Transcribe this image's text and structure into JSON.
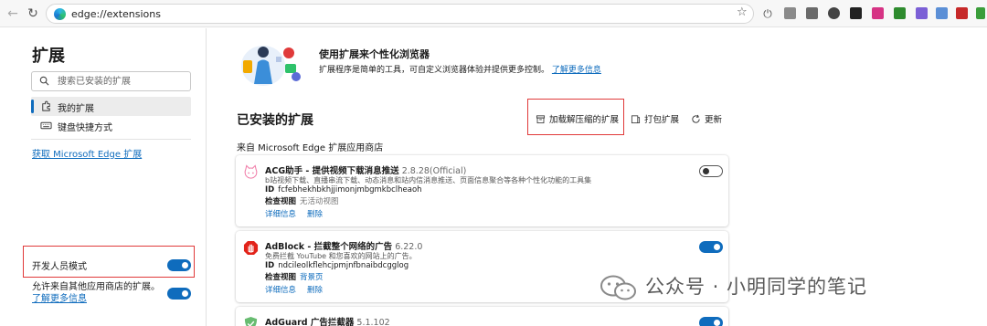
{
  "browser": {
    "url": "edge://extensions"
  },
  "sidebar": {
    "title": "扩展",
    "search_placeholder": "搜索已安装的扩展",
    "items": [
      {
        "label": "我的扩展",
        "active": true
      },
      {
        "label": "键盘快捷方式",
        "active": false
      }
    ],
    "store_link": "获取 Microsoft Edge 扩展",
    "dev_mode": {
      "label": "开发人员模式",
      "on": true
    },
    "allow_other": {
      "label": "允许来自其他应用商店的扩展。",
      "link": "了解更多信息",
      "on": true
    }
  },
  "promo": {
    "title": "使用扩展来个性化浏览器",
    "desc": "扩展程序是简单的工具，可自定义浏览器体验并提供更多控制。",
    "link": "了解更多信息"
  },
  "installed": {
    "title": "已安装的扩展",
    "actions": {
      "load_unpacked": "加载解压缩的扩展",
      "pack": "打包扩展",
      "update": "更新"
    },
    "source_label": "来自 Microsoft Edge 扩展应用商店",
    "extensions": [
      {
        "name": "ACG助手 - 提供视频下载消息推送",
        "version": "2.8.28(Official)",
        "desc": "b站视频下载、直播串流下载、动态消息和站内信消息推送、页面信息聚合等各种个性化功能的工具集",
        "id_label": "ID",
        "id": "fcfebhekhbkhjjimonjmbgmkbclheaoh",
        "view_label": "检查视图",
        "view_value": "无活动视图",
        "details": "详细信息",
        "remove": "删除",
        "enabled": false
      },
      {
        "name": "AdBlock - 拦截整个网络的广告",
        "version": "6.22.0",
        "desc": "免费拦截 YouTube 和您喜欢的网站上的广告。",
        "id_label": "ID",
        "id": "ndcileolkflehcjpmjnfbnaibdcgglog",
        "view_label": "检查视图",
        "view_value": "背景页",
        "details": "详细信息",
        "remove": "删除",
        "enabled": true
      },
      {
        "name": "AdGuard 广告拦截器",
        "version": "5.1.102",
        "enabled": true
      }
    ]
  },
  "watermark": {
    "text": "公众号 · 小明同学的笔记"
  },
  "colors": {
    "accent": "#0f6cbd",
    "highlight_box": "#e03a3a",
    "adblock_red": "#e2231a",
    "adguard_green": "#68bc71"
  }
}
